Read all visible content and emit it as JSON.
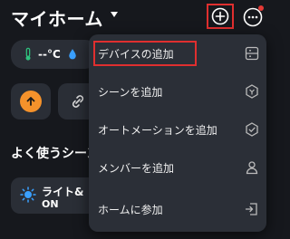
{
  "header": {
    "title": "マイホーム",
    "icons": {
      "title_caret": "chevron-down-icon",
      "add": "plus-circle-icon",
      "more": "more-horiz-icon"
    }
  },
  "weather": {
    "temperature": "--°C",
    "icons": [
      "thermometer-icon",
      "humidity-drop-icon"
    ]
  },
  "section_title": "よく使うシーン",
  "scene": {
    "name": "ライト&",
    "state": "ON"
  },
  "menu": {
    "items": [
      {
        "label": "デバイスの追加",
        "icon": "device-panel-icon",
        "highlighted": true
      },
      {
        "label": "シーンを追加",
        "icon": "scene-hexagon-icon"
      },
      {
        "label": "オートメーションを追加",
        "icon": "automation-shield-icon"
      },
      {
        "label": "メンバーを追加",
        "icon": "person-icon"
      },
      {
        "label": "ホームに参加",
        "icon": "join-home-icon"
      }
    ]
  },
  "colors": {
    "background": "#16181d",
    "card": "#2a2e36",
    "menu": "#2b2f37",
    "highlight": "#e02f2f",
    "accent_orange": "#f5922b"
  }
}
